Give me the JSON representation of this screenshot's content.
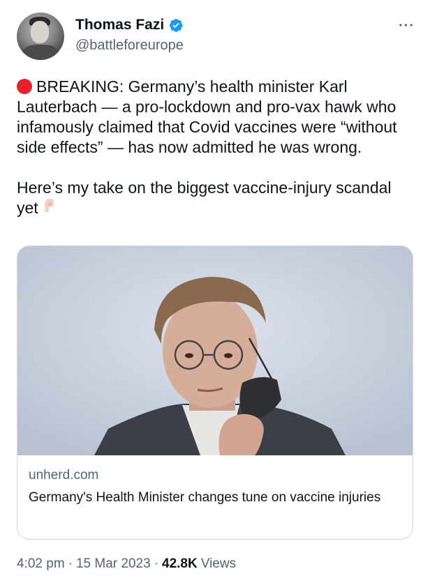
{
  "author": {
    "display_name": "Thomas Fazi",
    "handle": "@battleforeurope",
    "verified": true
  },
  "tweet": {
    "paragraph_1": "BREAKING: Germany’s health minister Karl Lauterbach — a pro-lockdown and pro-vax hawk who infamously claimed that Covid vaccines were “without side effects” — has now admitted he was wrong.",
    "paragraph_2": "Here’s my take on the biggest vaccine-injury scandal yet",
    "emoji_leading": "red-circle-icon",
    "emoji_trailing": "backhand-index-pointing-down-icon"
  },
  "card": {
    "domain": "unherd.com",
    "title": "Germany's Health Minister changes tune on vaccine injuries"
  },
  "footer": {
    "time": "4:02 pm",
    "separator": "·",
    "date": "15 Mar 2023",
    "views_count": "42.8K",
    "views_label": "Views"
  },
  "colors": {
    "text_primary": "#0f1419",
    "text_secondary": "#536471",
    "verified_blue": "#1d9bf0",
    "red_dot": "#e8212b",
    "card_border": "#cfd9de"
  }
}
